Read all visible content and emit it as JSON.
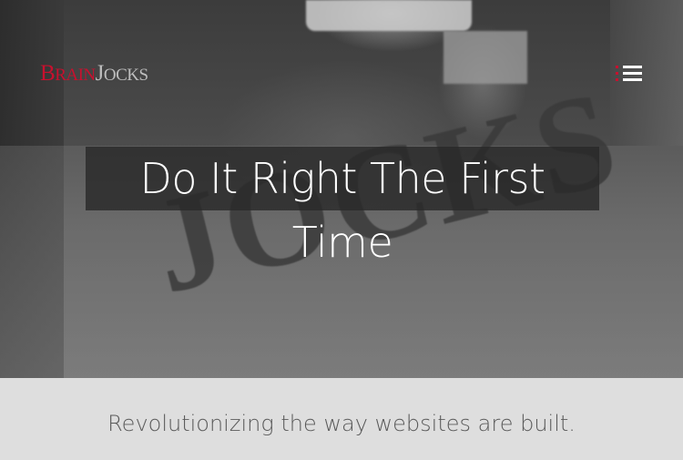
{
  "header": {
    "logo_part1_cap": "B",
    "logo_part1_rest": "RAIN",
    "logo_part2_cap": "J",
    "logo_part2_rest": "OCKS",
    "menu_icon": "hamburger-menu-icon"
  },
  "hero": {
    "headline": "Do It Right The First Time",
    "background_word": "JOCKS"
  },
  "tagline": {
    "text": "Revolutionizing the way websites are built."
  },
  "colors": {
    "brand_red": "#c8102e",
    "logo_gray": "#bdbdbd",
    "tagline_bg": "#dedede",
    "tagline_text": "#5a5a5a"
  }
}
